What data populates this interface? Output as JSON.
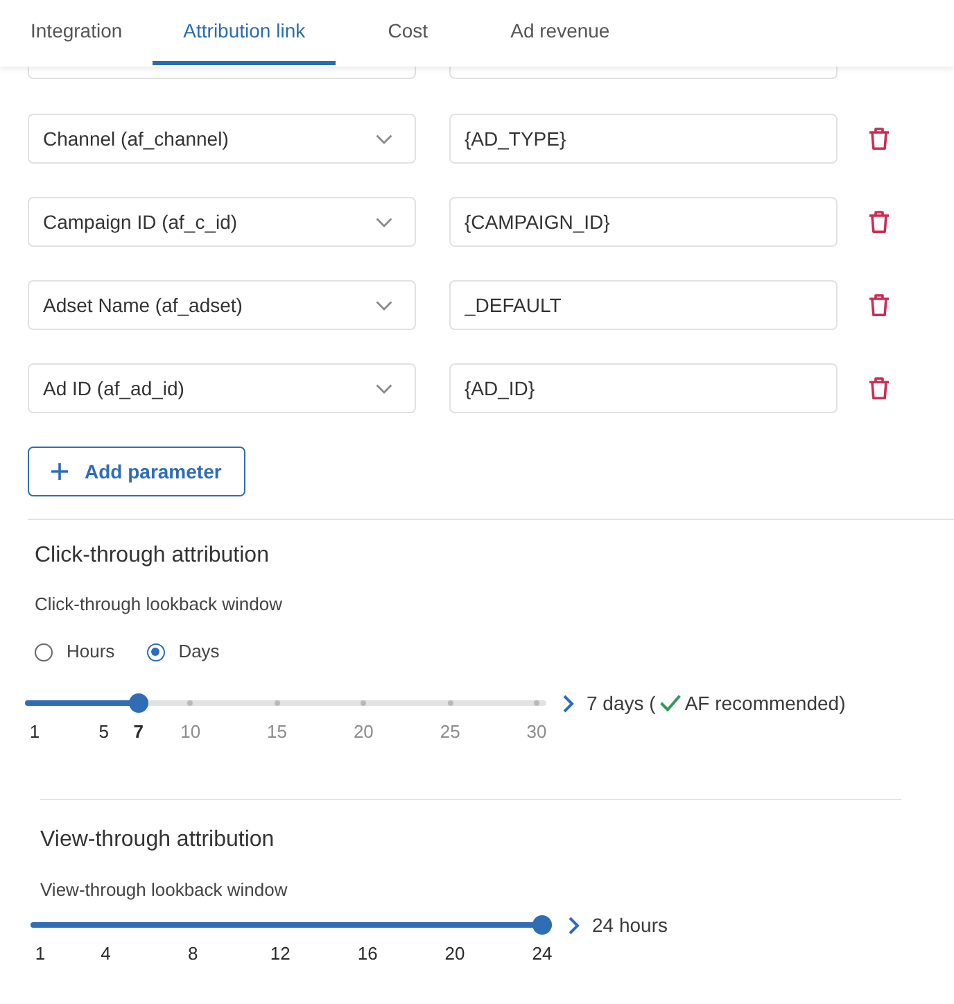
{
  "tabs": [
    {
      "label": "Integration",
      "selected": false
    },
    {
      "label": "Attribution link",
      "selected": true
    },
    {
      "label": "Cost",
      "selected": false
    },
    {
      "label": "Ad revenue",
      "selected": false
    }
  ],
  "parameters": [
    {
      "name": "Channel (af_channel)",
      "value": "{AD_TYPE}"
    },
    {
      "name": "Campaign ID (af_c_id)",
      "value": "{CAMPAIGN_ID}"
    },
    {
      "name": "Adset Name (af_adset)",
      "value": "_DEFAULT"
    },
    {
      "name": "Ad ID (af_ad_id)",
      "value": "{AD_ID}"
    }
  ],
  "add_parameter_button": {
    "label": "Add parameter"
  },
  "click_through": {
    "title": "Click-through attribution",
    "window_label": "Click-through lookback window",
    "units": [
      {
        "label": "Hours",
        "selected": false
      },
      {
        "label": "Days",
        "selected": true
      }
    ],
    "slider": {
      "level": 0.2069,
      "ticks": [
        {
          "label": "1",
          "selected": false
        },
        {
          "label": "5",
          "selected": false
        },
        {
          "label": "7",
          "selected": true
        },
        {
          "label": "10",
          "selected": false
        },
        {
          "label": "15",
          "selected": false
        },
        {
          "label": "20",
          "selected": false
        },
        {
          "label": "25",
          "selected": false
        },
        {
          "label": "30",
          "selected": false
        }
      ]
    },
    "reading": "7 days (",
    "recommendation": "AF recommended)"
  },
  "view_through": {
    "title": "View-through attribution",
    "window_label": "View-through lookback window",
    "slider": {
      "level": 1,
      "ticks": [
        {
          "label": "1"
        },
        {
          "label": "4"
        },
        {
          "label": "8"
        },
        {
          "label": "12"
        },
        {
          "label": "16"
        },
        {
          "label": "20"
        },
        {
          "label": "24"
        }
      ]
    },
    "reading": "24 hours"
  }
}
